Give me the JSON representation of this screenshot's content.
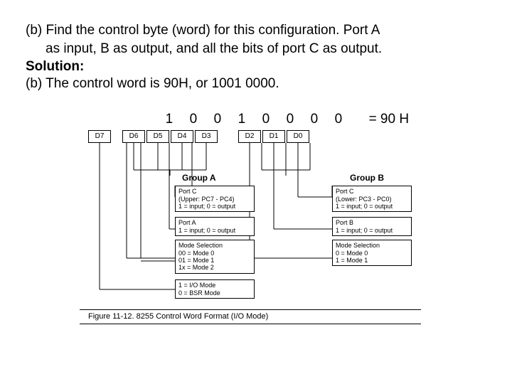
{
  "question": {
    "line1": "(b) Find the control byte (word) for this configuration. Port A",
    "line2": "as input, B as output, and all the bits of port C as output."
  },
  "solution_label": "Solution:",
  "answer_line": "(b) The control word is 90H, or 1001 0000.",
  "bits": {
    "b7": "1",
    "b6": "0",
    "b5": "0",
    "b4": "1",
    "b3": "0",
    "b2": "0",
    "b1": "0",
    "b0": "0",
    "eq": "= 90 H"
  },
  "bit_labels": {
    "d7": "D7",
    "d6": "D6",
    "d5": "D5",
    "d4": "D4",
    "d3": "D3",
    "d2": "D2",
    "d1": "D1",
    "d0": "D0"
  },
  "groups": {
    "a": "Group A",
    "b": "Group B"
  },
  "boxes": {
    "a_portc": {
      "t": "Port C",
      "l1": "(Upper: PC7 - PC4)",
      "l2": "1 = input; 0 = output"
    },
    "a_porta": {
      "t": "Port A",
      "l1": "1 = input; 0 = output"
    },
    "a_mode": {
      "t": "Mode Selection",
      "l1": "00 = Mode 0",
      "l2": "01 = Mode 1",
      "l3": "1x = Mode 2"
    },
    "a_d7": {
      "l1": "1 = I/O Mode",
      "l2": "0 = BSR Mode"
    },
    "b_portc": {
      "t": "Port C",
      "l1": "(Lower: PC3 - PC0)",
      "l2": "1 = input; 0 = output"
    },
    "b_portb": {
      "t": "Port B",
      "l1": "1 = input; 0 = output"
    },
    "b_mode": {
      "t": "Mode Selection",
      "l1": "0 = Mode 0",
      "l2": "1 = Mode 1"
    }
  },
  "caption": "Figure 11-12. 8255 Control Word Format (I/O Mode)",
  "chart_data": {
    "type": "table",
    "title": "8255 Control Word bit layout",
    "bits": [
      "D7",
      "D6",
      "D5",
      "D4",
      "D3",
      "D2",
      "D1",
      "D0"
    ],
    "example_value": [
      "1",
      "0",
      "0",
      "1",
      "0",
      "0",
      "0",
      "0"
    ],
    "example_hex": "90H",
    "fields": [
      {
        "bits": [
          "D7"
        ],
        "meaning": "1 = I/O Mode, 0 = BSR Mode",
        "group": ""
      },
      {
        "bits": [
          "D6",
          "D5"
        ],
        "meaning": "Group A Mode Selection: 00=Mode0 01=Mode1 1x=Mode2",
        "group": "A"
      },
      {
        "bits": [
          "D4"
        ],
        "meaning": "Port A: 1=input 0=output",
        "group": "A"
      },
      {
        "bits": [
          "D3"
        ],
        "meaning": "Port C Upper PC7-PC4: 1=input 0=output",
        "group": "A"
      },
      {
        "bits": [
          "D2"
        ],
        "meaning": "Group B Mode Selection: 0=Mode0 1=Mode1",
        "group": "B"
      },
      {
        "bits": [
          "D1"
        ],
        "meaning": "Port B: 1=input 0=output",
        "group": "B"
      },
      {
        "bits": [
          "D0"
        ],
        "meaning": "Port C Lower PC3-PC0: 1=input 0=output",
        "group": "B"
      }
    ]
  }
}
